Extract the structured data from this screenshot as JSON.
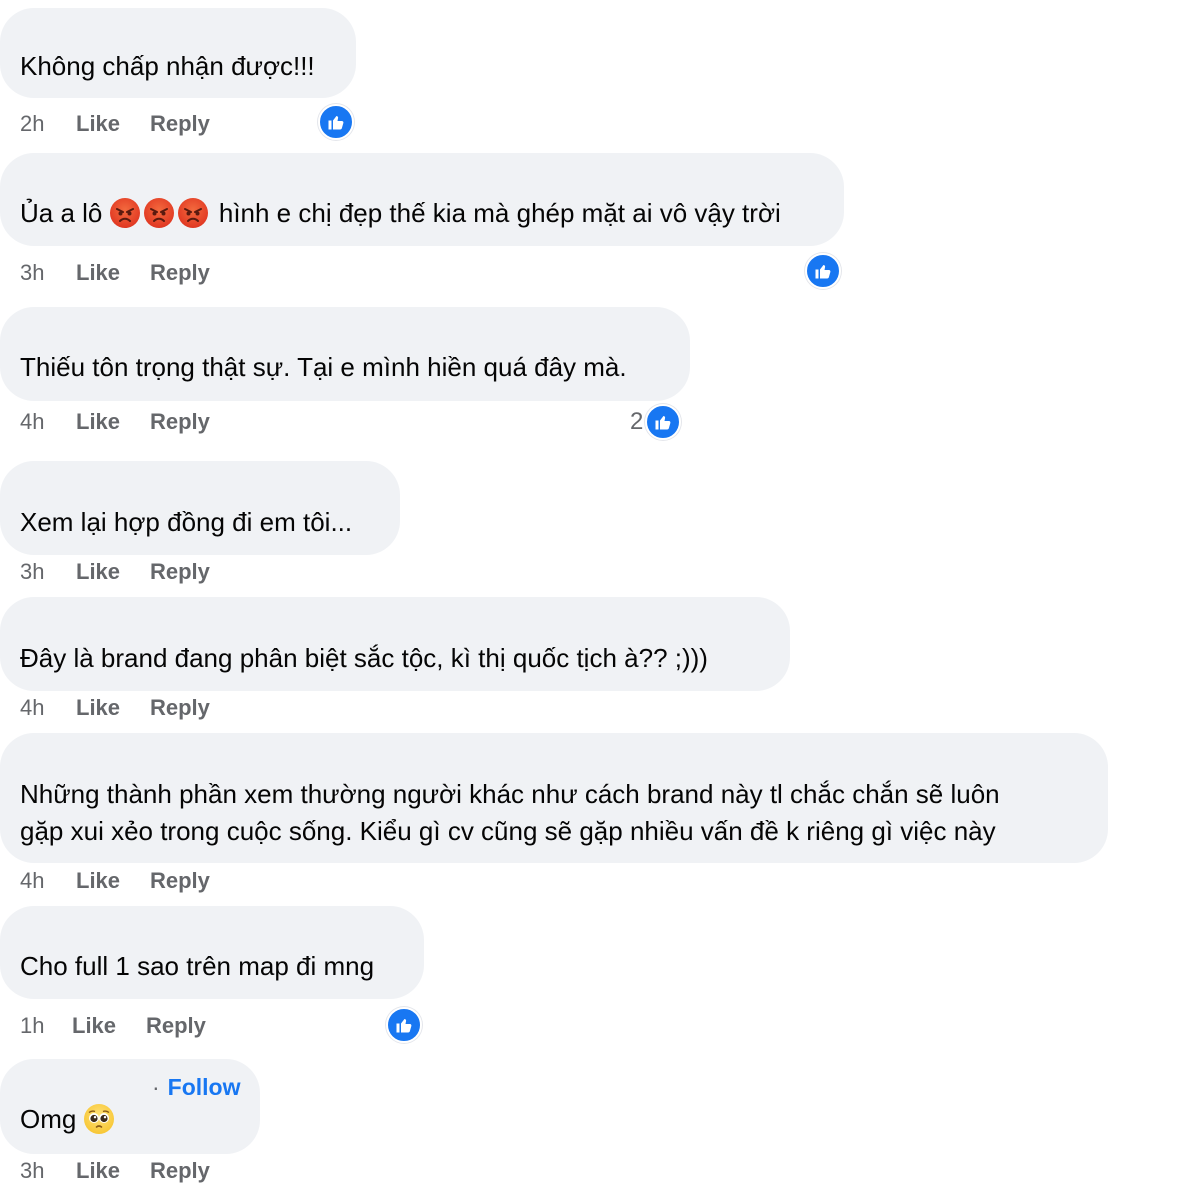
{
  "colors": {
    "bubble_bg": "#f0f2f5",
    "meta_text": "#65676b",
    "like_blue": "#1877f2",
    "link": "#1877f2"
  },
  "actions": {
    "like": "Like",
    "reply": "Reply"
  },
  "comments": [
    {
      "text": "Không chấp nhận được!!!",
      "time": "2h",
      "reaction": {
        "icon": "thumbs-up-icon",
        "count": ""
      }
    },
    {
      "text_before": "Ủa a lô",
      "emojis": [
        "angry-face-icon",
        "angry-face-icon",
        "angry-face-icon"
      ],
      "text_after": "hình e chị đẹp thế kia mà ghép mặt ai vô vậy trời",
      "time": "3h",
      "reaction": {
        "icon": "thumbs-up-icon",
        "count": ""
      }
    },
    {
      "text": "Thiếu tôn trọng thật sự. Tại e mình hiền quá đây mà.",
      "time": "4h",
      "reaction": {
        "icon": "thumbs-up-icon",
        "count": "2"
      }
    },
    {
      "text": "Xem lại hợp đồng đi em tôi...",
      "time": "3h"
    },
    {
      "text": "Đây là brand đang phân biệt sắc tộc, kì thị quốc tịch à?? ;)))",
      "time": "4h"
    },
    {
      "lines": [
        "Những thành phần xem thường người khác như cách brand này tl chắc chắn sẽ luôn",
        "gặp xui xẻo trong cuộc sống. Kiểu gì cv cũng sẽ gặp nhiều vấn đề  k riêng gì việc này"
      ],
      "time": "4h"
    },
    {
      "text": "Cho full 1 sao trên map đi mng",
      "time": "1h",
      "reaction": {
        "icon": "thumbs-up-icon",
        "count": ""
      }
    },
    {
      "follow_dot": "·",
      "follow_label": "Follow",
      "text": "Omg",
      "emoji": "pleading-face-icon",
      "time": "3h"
    }
  ]
}
